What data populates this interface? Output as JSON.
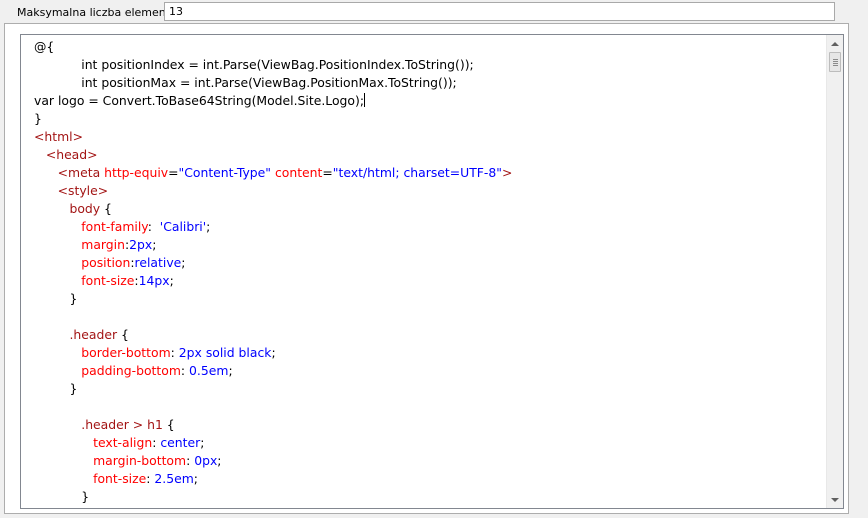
{
  "max_elements": {
    "label": "Maksymalna liczba elementów",
    "value": "13"
  },
  "code_lines": [
    [
      [
        "plain",
        "@{"
      ]
    ],
    [
      [
        "plain",
        "            int positionIndex = int.Parse(ViewBag.PositionIndex.ToString());"
      ]
    ],
    [
      [
        "plain",
        "            int positionMax = int.Parse(ViewBag.PositionMax.ToString());"
      ]
    ],
    [
      [
        "plain",
        "var logo = Convert.ToBase64String(Model.Site.Logo);"
      ]
    ],
    [
      [
        "plain",
        "}"
      ]
    ],
    [
      [
        "tag",
        "<html>"
      ]
    ],
    [
      [
        "plain",
        "   "
      ],
      [
        "tag",
        "<head>"
      ]
    ],
    [
      [
        "plain",
        "      "
      ],
      [
        "tag",
        "<meta "
      ],
      [
        "attr",
        "http-equiv"
      ],
      [
        "plain",
        "="
      ],
      [
        "val",
        "\"Content-Type\""
      ],
      [
        "plain",
        " "
      ],
      [
        "attr",
        "content"
      ],
      [
        "plain",
        "="
      ],
      [
        "val",
        "\"text/html; charset=UTF-8\""
      ],
      [
        "tag",
        ">"
      ]
    ],
    [
      [
        "plain",
        "      "
      ],
      [
        "tag",
        "<style>"
      ]
    ],
    [
      [
        "plain",
        "         "
      ],
      [
        "tag",
        "body"
      ],
      [
        "plain",
        " {"
      ]
    ],
    [
      [
        "plain",
        "            "
      ],
      [
        "attr",
        "font-family"
      ],
      [
        "plain",
        ":  "
      ],
      [
        "val",
        "'Calibri'"
      ],
      [
        "plain",
        ";"
      ]
    ],
    [
      [
        "plain",
        "            "
      ],
      [
        "attr",
        "margin"
      ],
      [
        "plain",
        ":"
      ],
      [
        "val",
        "2px"
      ],
      [
        "plain",
        ";"
      ]
    ],
    [
      [
        "plain",
        "            "
      ],
      [
        "attr",
        "position"
      ],
      [
        "plain",
        ":"
      ],
      [
        "val",
        "relative"
      ],
      [
        "plain",
        ";"
      ]
    ],
    [
      [
        "plain",
        "            "
      ],
      [
        "attr",
        "font-size"
      ],
      [
        "plain",
        ":"
      ],
      [
        "val",
        "14px"
      ],
      [
        "plain",
        ";"
      ]
    ],
    [
      [
        "plain",
        "         }"
      ]
    ],
    [
      [
        "plain",
        ""
      ]
    ],
    [
      [
        "plain",
        "         "
      ],
      [
        "tag",
        ".header"
      ],
      [
        "plain",
        " {"
      ]
    ],
    [
      [
        "plain",
        "            "
      ],
      [
        "attr",
        "border-bottom"
      ],
      [
        "plain",
        ": "
      ],
      [
        "val",
        "2px solid black"
      ],
      [
        "plain",
        ";"
      ]
    ],
    [
      [
        "plain",
        "            "
      ],
      [
        "attr",
        "padding-bottom"
      ],
      [
        "plain",
        ": "
      ],
      [
        "val",
        "0.5em"
      ],
      [
        "plain",
        ";"
      ]
    ],
    [
      [
        "plain",
        "         }"
      ]
    ],
    [
      [
        "plain",
        ""
      ]
    ],
    [
      [
        "plain",
        "            "
      ],
      [
        "tag",
        ".header > h1"
      ],
      [
        "plain",
        " {"
      ]
    ],
    [
      [
        "plain",
        "               "
      ],
      [
        "attr",
        "text-align"
      ],
      [
        "plain",
        ": "
      ],
      [
        "val",
        "center"
      ],
      [
        "plain",
        ";"
      ]
    ],
    [
      [
        "plain",
        "               "
      ],
      [
        "attr",
        "margin-bottom"
      ],
      [
        "plain",
        ": "
      ],
      [
        "val",
        "0px"
      ],
      [
        "plain",
        ";"
      ]
    ],
    [
      [
        "plain",
        "               "
      ],
      [
        "attr",
        "font-size"
      ],
      [
        "plain",
        ": "
      ],
      [
        "val",
        "2.5em"
      ],
      [
        "plain",
        ";"
      ]
    ],
    [
      [
        "plain",
        "            }"
      ]
    ]
  ]
}
